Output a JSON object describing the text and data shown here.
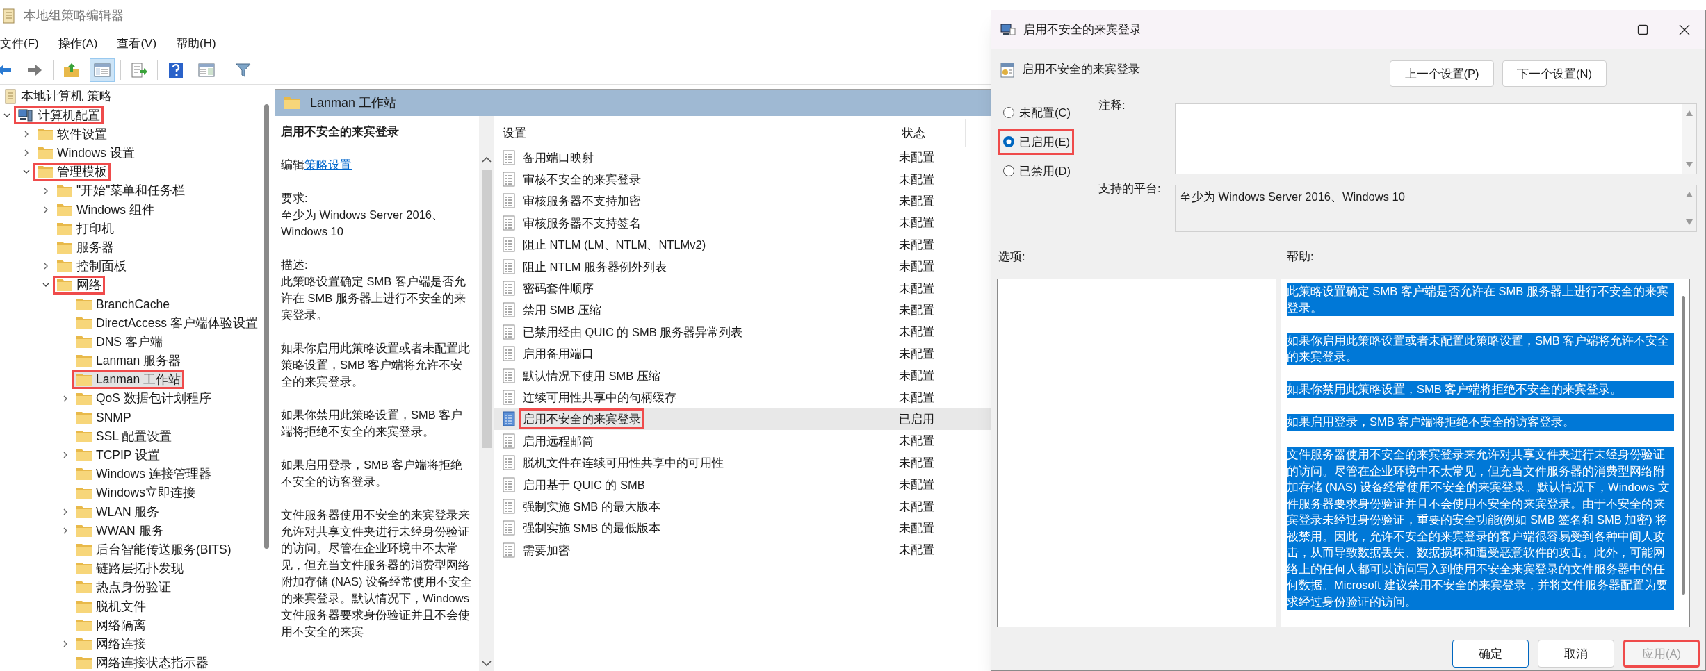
{
  "main_window": {
    "title": "本地组策略编辑器"
  },
  "menu": [
    "文件(F)",
    "操作(A)",
    "查看(V)",
    "帮助(H)"
  ],
  "toolbar": [
    {
      "kind": "back",
      "pressed": false
    },
    {
      "kind": "forward",
      "pressed": false
    },
    {
      "kind": "up",
      "pressed": false
    },
    {
      "kind": "tree",
      "pressed": true
    },
    {
      "kind": "export",
      "pressed": false
    },
    {
      "kind": "help",
      "pressed": false
    },
    {
      "kind": "view",
      "pressed": false
    },
    {
      "kind": "filter",
      "pressed": false
    }
  ],
  "tree": [
    {
      "label": "本地计算机 策略",
      "kind": "policy",
      "selected": false,
      "marked": false,
      "children": [
        {
          "label": "计算机配置",
          "kind": "computer",
          "selected": false,
          "marked": true,
          "expanded": true,
          "children": [
            {
              "label": "软件设置",
              "kind": "folder",
              "selected": false,
              "marked": false,
              "expanded": false
            },
            {
              "label": "Windows 设置",
              "kind": "folder",
              "selected": false,
              "marked": false,
              "expanded": false
            },
            {
              "label": "管理模板",
              "kind": "folder",
              "selected": false,
              "marked": true,
              "expanded": true,
              "children": [
                {
                  "label": "\"开始\"菜单和任务栏",
                  "kind": "folder",
                  "selected": false,
                  "marked": false,
                  "expanded": false
                },
                {
                  "label": "Windows 组件",
                  "kind": "folder",
                  "selected": false,
                  "marked": false,
                  "expanded": false
                },
                {
                  "label": "打印机",
                  "kind": "folder",
                  "selected": false,
                  "marked": false
                },
                {
                  "label": "服务器",
                  "kind": "folder",
                  "selected": false,
                  "marked": false
                },
                {
                  "label": "控制面板",
                  "kind": "folder",
                  "selected": false,
                  "marked": false,
                  "expanded": false
                },
                {
                  "label": "网络",
                  "kind": "folder",
                  "selected": false,
                  "marked": true,
                  "expanded": true,
                  "children": [
                    {
                      "label": "BranchCache",
                      "kind": "folder",
                      "selected": false,
                      "marked": false
                    },
                    {
                      "label": "DirectAccess 客户端体验设置",
                      "kind": "folder",
                      "selected": false,
                      "marked": false
                    },
                    {
                      "label": "DNS 客户端",
                      "kind": "folder",
                      "selected": false,
                      "marked": false
                    },
                    {
                      "label": "Lanman 服务器",
                      "kind": "folder",
                      "selected": false,
                      "marked": false
                    },
                    {
                      "label": "Lanman 工作站",
                      "kind": "folder",
                      "selected": true,
                      "marked": true
                    },
                    {
                      "label": "QoS 数据包计划程序",
                      "kind": "folder",
                      "selected": false,
                      "marked": false,
                      "expanded": false
                    },
                    {
                      "label": "SNMP",
                      "kind": "folder",
                      "selected": false,
                      "marked": false
                    },
                    {
                      "label": "SSL 配置设置",
                      "kind": "folder",
                      "selected": false,
                      "marked": false
                    },
                    {
                      "label": "TCPIP 设置",
                      "kind": "folder",
                      "selected": false,
                      "marked": false,
                      "expanded": false
                    },
                    {
                      "label": "Windows 连接管理器",
                      "kind": "folder",
                      "selected": false,
                      "marked": false
                    },
                    {
                      "label": "Windows立即连接",
                      "kind": "folder",
                      "selected": false,
                      "marked": false
                    },
                    {
                      "label": "WLAN 服务",
                      "kind": "folder",
                      "selected": false,
                      "marked": false,
                      "expanded": false
                    },
                    {
                      "label": "WWAN 服务",
                      "kind": "folder",
                      "selected": false,
                      "marked": false,
                      "expanded": false
                    },
                    {
                      "label": "后台智能传送服务(BITS)",
                      "kind": "folder",
                      "selected": false,
                      "marked": false
                    },
                    {
                      "label": "链路层拓扑发现",
                      "kind": "folder",
                      "selected": false,
                      "marked": false
                    },
                    {
                      "label": "热点身份验证",
                      "kind": "folder",
                      "selected": false,
                      "marked": false
                    },
                    {
                      "label": "脱机文件",
                      "kind": "folder",
                      "selected": false,
                      "marked": false
                    },
                    {
                      "label": "网络隔离",
                      "kind": "folder",
                      "selected": false,
                      "marked": false
                    },
                    {
                      "label": "网络连接",
                      "kind": "folder",
                      "selected": false,
                      "marked": false,
                      "expanded": false
                    },
                    {
                      "label": "网络连接状态指示器",
                      "kind": "folder",
                      "selected": false,
                      "marked": false
                    }
                  ]
                }
              ]
            }
          ]
        }
      ]
    }
  ],
  "details_header": "Lanman 工作站",
  "description": {
    "title": "启用不安全的来宾登录",
    "edit_prefix": "编辑",
    "edit_link": "策略设置",
    "requirements_label": "要求:",
    "requirements": "至少为 Windows Server 2016、Windows 10",
    "description_label": "描述:",
    "paragraphs": [
      "此策略设置确定 SMB 客户端是否允许在 SMB 服务器上进行不安全的来宾登录。",
      "如果你启用此策略设置或者未配置此策略设置，SMB 客户端将允许不安全的来宾登录。",
      "如果你禁用此策略设置，SMB 客户端将拒绝不安全的来宾登录。",
      "如果启用登录，SMB 客户端将拒绝不安全的访客登录。",
      "文件服务器使用不安全的来宾登录来允许对共享文件夹进行未经身份验证的访问。尽管在企业环境中不太常见，但充当文件服务器的消费型网络附加存储 (NAS) 设备经常使用不安全的来宾登录。默认情况下，Windows 文件服务器要求身份验证并且不会使用不安全的来宾"
    ]
  },
  "table": {
    "columns": [
      "设置",
      "状态"
    ],
    "rows": [
      {
        "name": "备用端口映射",
        "state": "未配置",
        "selected": false,
        "marked": false
      },
      {
        "name": "审核不安全的来宾登录",
        "state": "未配置",
        "selected": false,
        "marked": false
      },
      {
        "name": "审核服务器不支持加密",
        "state": "未配置",
        "selected": false,
        "marked": false
      },
      {
        "name": "审核服务器不支持签名",
        "state": "未配置",
        "selected": false,
        "marked": false
      },
      {
        "name": "阻止 NTLM (LM、NTLM、NTLMv2)",
        "state": "未配置",
        "selected": false,
        "marked": false
      },
      {
        "name": "阻止 NTLM 服务器例外列表",
        "state": "未配置",
        "selected": false,
        "marked": false
      },
      {
        "name": "密码套件顺序",
        "state": "未配置",
        "selected": false,
        "marked": false
      },
      {
        "name": "禁用 SMB 压缩",
        "state": "未配置",
        "selected": false,
        "marked": false
      },
      {
        "name": "已禁用经由 QUIC 的 SMB 服务器异常列表",
        "state": "未配置",
        "selected": false,
        "marked": false
      },
      {
        "name": "启用备用端口",
        "state": "未配置",
        "selected": false,
        "marked": false
      },
      {
        "name": "默认情况下使用 SMB 压缩",
        "state": "未配置",
        "selected": false,
        "marked": false
      },
      {
        "name": "连续可用性共享中的句柄缓存",
        "state": "未配置",
        "selected": false,
        "marked": false
      },
      {
        "name": "启用不安全的来宾登录",
        "state": "已启用",
        "selected": true,
        "marked": true
      },
      {
        "name": "启用远程邮筒",
        "state": "未配置",
        "selected": false,
        "marked": false
      },
      {
        "name": "脱机文件在连续可用性共享中的可用性",
        "state": "未配置",
        "selected": false,
        "marked": false
      },
      {
        "name": "启用基于 QUIC 的 SMB",
        "state": "未配置",
        "selected": false,
        "marked": false
      },
      {
        "name": "强制实施 SMB 的最大版本",
        "state": "未配置",
        "selected": false,
        "marked": false
      },
      {
        "name": "强制实施 SMB 的最低版本",
        "state": "未配置",
        "selected": false,
        "marked": false
      },
      {
        "name": "需要加密",
        "state": "未配置",
        "selected": false,
        "marked": false
      }
    ]
  },
  "dialog": {
    "title": "启用不安全的来宾登录",
    "header": "启用不安全的来宾登录",
    "nav_buttons": [
      "上一个设置(P)",
      "下一个设置(N)"
    ],
    "radios": [
      {
        "label": "未配置(C)",
        "selected": false,
        "marked": false
      },
      {
        "label": "已启用(E)",
        "selected": true,
        "marked": true
      },
      {
        "label": "已禁用(D)",
        "selected": false,
        "marked": false
      }
    ],
    "comment_label": "注释:",
    "platform_label": "支持的平台:",
    "platform": "至少为 Windows Server 2016、Windows 10",
    "options_label": "选项:",
    "help_label": "帮助:",
    "help_selected": true,
    "help_paragraphs": [
      "此策略设置确定 SMB 客户端是否允许在 SMB 服务器上进行不安全的来宾登录。",
      "如果你启用此策略设置或者未配置此策略设置，SMB 客户端将允许不安全的来宾登录。",
      "如果你禁用此策略设置，SMB 客户端将拒绝不安全的来宾登录。",
      "如果启用登录，SMB 客户端将拒绝不安全的访客登录。",
      "文件服务器使用不安全的来宾登录来允许对共享文件夹进行未经身份验证的访问。尽管在企业环境中不太常见，但充当文件服务器的消费型网络附加存储 (NAS) 设备经常使用不安全的来宾登录。默认情况下，Windows 文件服务器要求身份验证并且不会使用不安全的来宾登录。由于不安全的来宾登录未经过身份验证，重要的安全功能(例如 SMB 签名和 SMB 加密) 将被禁用。因此，允许不安全的来宾登录的客户端很容易受到各种中间人攻击，从而导致数据丢失、数据损坏和遭受恶意软件的攻击。此外，可能网络上的任何人都可以访问写入到使用不安全来宾登录的文件服务器中的任何数据。Microsoft 建议禁用不安全的来宾登录，并将文件服务器配置为要求经过身份验证的访问。"
    ],
    "buttons": [
      {
        "label": "确定",
        "kind": "ok",
        "disabled": false,
        "marked": false
      },
      {
        "label": "取消",
        "kind": "cancel",
        "disabled": false,
        "marked": false
      },
      {
        "label": "应用(A)",
        "kind": "apply",
        "disabled": true,
        "marked": true
      }
    ]
  }
}
